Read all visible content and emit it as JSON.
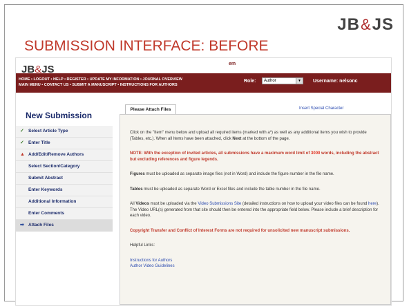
{
  "logo": {
    "left": "JB",
    "amp": "&",
    "right": "JS"
  },
  "slide_title": "SUBMISSION INTERFACE: BEFORE",
  "header": {
    "jbjs_left": "JB",
    "jbjs_amp": "&",
    "jbjs_right": "JS",
    "em_badge": "em",
    "em_line1": "Editorial",
    "em_line2": "Manager",
    "nav_line1": "HOME • LOGOUT • HELP • REGISTER • UPDATE MY INFORMATION • JOURNAL OVERVIEW",
    "nav_line2": "MAIN MENU • CONTACT US • SUBMIT A MANUSCRIPT • INSTRUCTIONS FOR AUTHORS",
    "role_label": "Role:",
    "role_value": "Author",
    "username": "Username: nelsonc"
  },
  "sidebar": {
    "title": "New Submission",
    "items": [
      {
        "label": "Select Article Type",
        "mark": "✓"
      },
      {
        "label": "Enter Title",
        "mark": "✓"
      },
      {
        "label": "Add/Edit/Remove Authors",
        "mark": "▲"
      },
      {
        "label": "Select Section/Category",
        "mark": ""
      },
      {
        "label": "Submit Abstract",
        "mark": ""
      },
      {
        "label": "Enter Keywords",
        "mark": ""
      },
      {
        "label": "Additional Information",
        "mark": ""
      },
      {
        "label": "Enter Comments",
        "mark": ""
      },
      {
        "label": "Attach Files",
        "mark": "➡"
      }
    ]
  },
  "tab_label": "Please Attach Files",
  "insert_special": "Insert Special Character",
  "content": {
    "p1": "Click on the \"Item\" menu below and upload all required items (marked with a*) as well as any additional items you wish to provide (Tables, etc.). When all Items have been attached, click",
    "p1_next": "Next",
    "p1_end": "at the bottom of the page.",
    "note_a": "NOTE: With the exception of invited articles, all submissions have a maximum word limit of",
    "note_limit": "3000",
    "note_b": "words, including the abstract but excluding references and figure legends.",
    "figures_b": "Figures",
    "figures_t": "must be uploaded as separate image files (not in Word) and include the figure number in the file name.",
    "tables_b": "Tables",
    "tables_t": "must be uploaded as separate Word or Excel files and include the table number in the file name.",
    "videos_a": "All",
    "videos_b": "Videos",
    "videos_c": "must be uploaded via the",
    "videos_link": "Video Submissions Site",
    "videos_d": "(detailed instructions on how to upload your video files can be found",
    "videos_here": "here",
    "videos_e": "). The Video URL(s) generated from that site should then be entered into the appropriate field below. Please include a brief description for each video.",
    "copyright": "Copyright Transfer and Conflict of Interest Forms are not required for unsolicited new manuscript submissions.",
    "helpful": "Helpful Links:",
    "link1": "Instructions for Authors",
    "link2": "Author Video Guidelines"
  }
}
